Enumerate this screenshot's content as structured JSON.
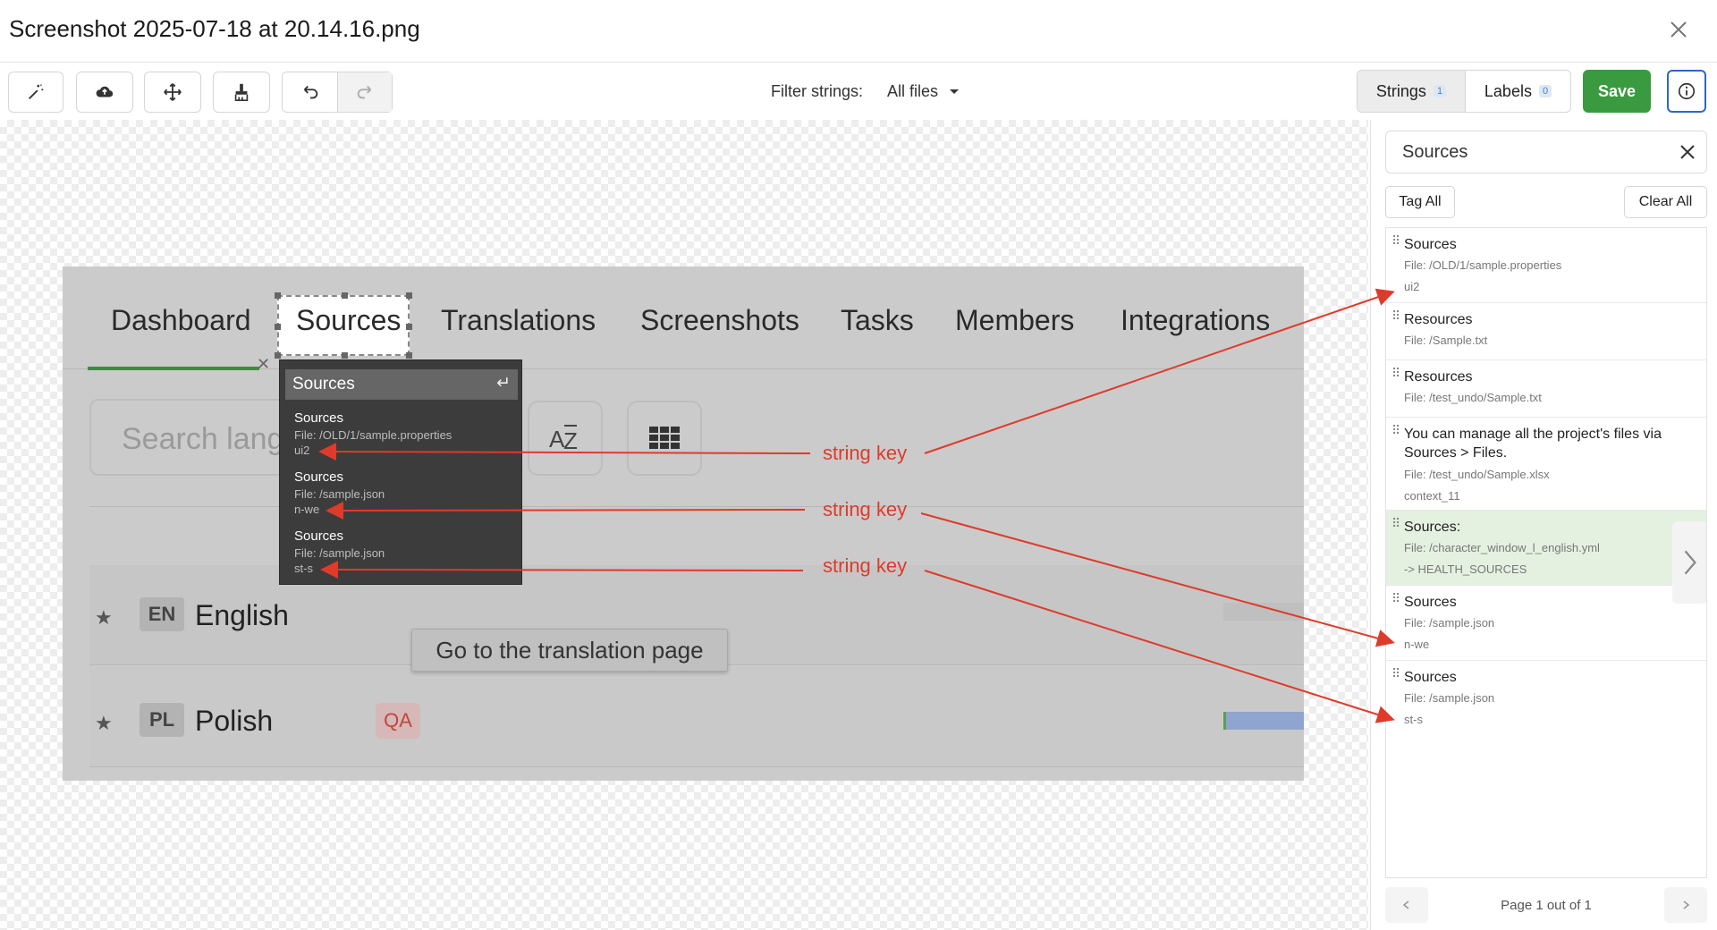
{
  "window": {
    "title": "Screenshot 2025-07-18 at 20.14.16.png",
    "close_icon": "close-icon"
  },
  "toolbar": {
    "tools": [
      {
        "icon": "magic-wand-icon"
      },
      {
        "icon": "cloud-upload-icon"
      },
      {
        "icon": "move-icon"
      },
      {
        "icon": "brush-icon"
      },
      {
        "icon": "undo-icon"
      },
      {
        "icon": "redo-icon"
      }
    ],
    "filter_label": "Filter strings:",
    "filter_value": "All files",
    "strings_tab": {
      "label": "Strings",
      "count": "1"
    },
    "labels_tab": {
      "label": "Labels",
      "count": "0"
    },
    "save_label": "Save",
    "info_icon": "info-icon",
    "save_color": "#3a9a3f"
  },
  "screenshot": {
    "tabs": [
      "Dashboard",
      "Sources",
      "Translations",
      "Screenshots",
      "Tasks",
      "Members",
      "Integrations"
    ],
    "search_placeholder": "Search lang",
    "sort_icon": "az-sort-icon",
    "grid_icon": "grid-view-icon",
    "languages": [
      {
        "code": "EN",
        "name": "English",
        "badge": ""
      },
      {
        "code": "PL",
        "name": "Polish",
        "badge": "QA"
      }
    ],
    "goto_label": "Go to the translation page",
    "popup": {
      "title": "Sources",
      "items": [
        {
          "name": "Sources",
          "file": "File: /OLD/1/sample.properties",
          "key": "ui2"
        },
        {
          "name": "Sources",
          "file": "File: /sample.json",
          "key": "n-we"
        },
        {
          "name": "Sources",
          "file": "File: /sample.json",
          "key": "st-s"
        }
      ]
    }
  },
  "annotations": {
    "label": "string key",
    "color": "#e03a2a"
  },
  "panel": {
    "search_value": "Sources",
    "tag_all": "Tag All",
    "clear_all": "Clear All",
    "items": [
      {
        "name": "Sources",
        "file": "File: /OLD/1/sample.properties",
        "key": "ui2",
        "selected": false
      },
      {
        "name": "Resources",
        "file": "File: /Sample.txt",
        "key": "",
        "selected": false
      },
      {
        "name": "Resources",
        "file": "File: /test_undo/Sample.txt",
        "key": "",
        "selected": false
      },
      {
        "name": "You can manage all the project's files via Sources > Files.",
        "file": "File: /test_undo/Sample.xlsx",
        "key": "context_11",
        "selected": false
      },
      {
        "name": "Sources:",
        "file": "File: /character_window_l_english.yml",
        "key": "-> HEALTH_SOURCES",
        "selected": true
      },
      {
        "name": "Sources",
        "file": "File: /sample.json",
        "key": "n-we",
        "selected": false
      },
      {
        "name": "Sources",
        "file": "File: /sample.json",
        "key": "st-s",
        "selected": false
      }
    ],
    "pager": "Page 1 out of 1",
    "selected_color": "#e4f1e1"
  }
}
